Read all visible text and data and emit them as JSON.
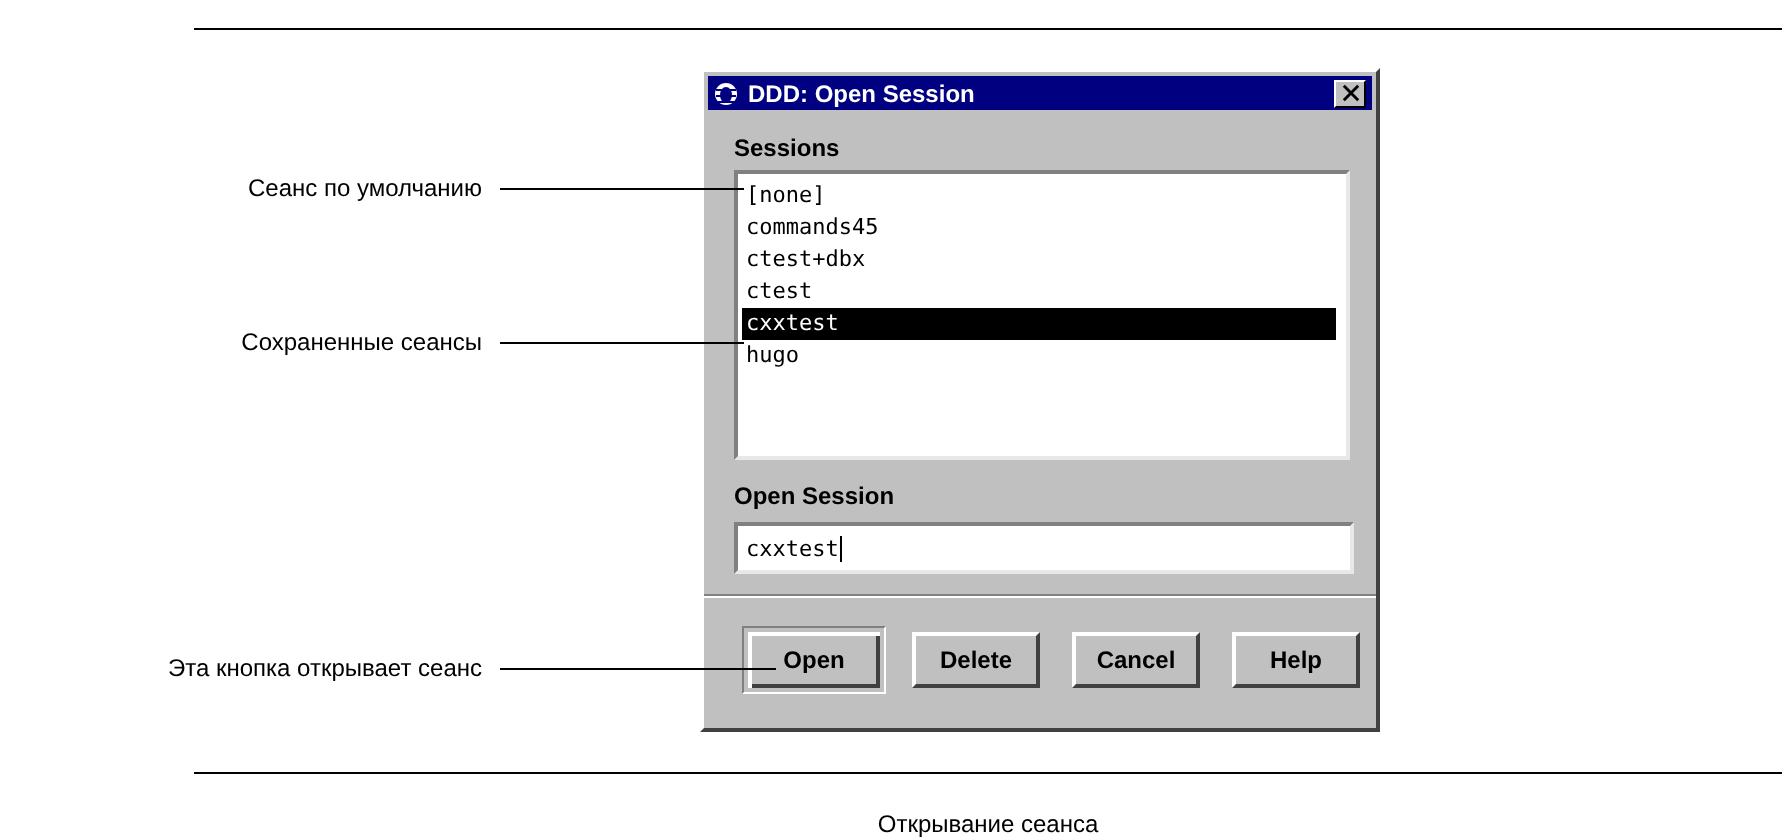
{
  "dialog": {
    "title": "DDD: Open Session",
    "sessions_label": "Sessions",
    "sessions": [
      {
        "name": "[none]",
        "selected": false
      },
      {
        "name": "commands45",
        "selected": false
      },
      {
        "name": "ctest+dbx",
        "selected": false
      },
      {
        "name": "ctest",
        "selected": false
      },
      {
        "name": "cxxtest",
        "selected": true
      },
      {
        "name": "hugo",
        "selected": false
      }
    ],
    "field_label": "Open Session",
    "field_value": "cxxtest",
    "buttons": [
      {
        "label": "Open",
        "default": true
      },
      {
        "label": "Delete",
        "default": false
      },
      {
        "label": "Cancel",
        "default": false
      },
      {
        "label": "Help",
        "default": false
      }
    ]
  },
  "callouts": [
    "Сеанс по умолчанию",
    "Сохраненные сеансы",
    "Эта кнопка открывает сеанс"
  ],
  "caption": "Открывание сеанса"
}
